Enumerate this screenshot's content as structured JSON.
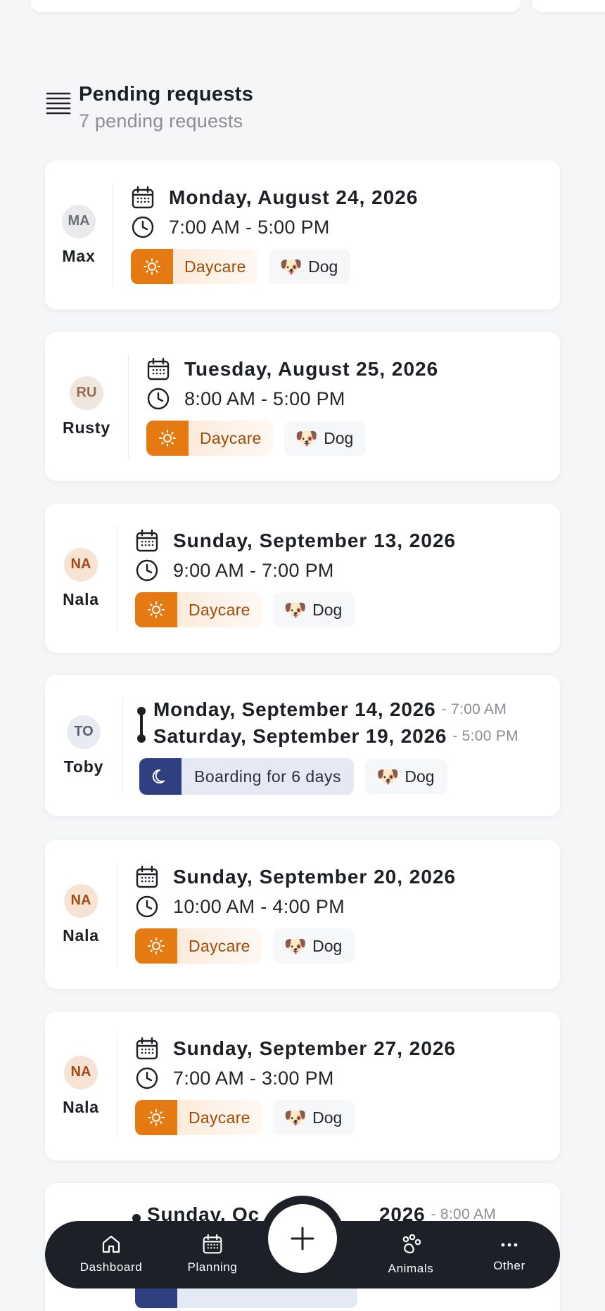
{
  "section": {
    "title": "Pending requests",
    "subtitle": "7 pending requests"
  },
  "requests": [
    {
      "initials": "MA",
      "name": "Max",
      "date": "Monday, August 24, 2026",
      "time": "7:00 AM - 5:00 PM",
      "service": "Daycare",
      "animal": "Dog"
    },
    {
      "initials": "RU",
      "name": "Rusty",
      "date": "Tuesday, August 25, 2026",
      "time": "8:00 AM - 5:00 PM",
      "service": "Daycare",
      "animal": "Dog"
    },
    {
      "initials": "NA",
      "name": "Nala",
      "date": "Sunday, September 13, 2026",
      "time": "9:00 AM - 7:00 PM",
      "service": "Daycare",
      "animal": "Dog"
    },
    {
      "initials": "TO",
      "name": "Toby",
      "start_date": "Monday, September 14, 2026",
      "start_time": "- 7:00 AM",
      "end_date": "Saturday, September 19, 2026",
      "end_time": "- 5:00 PM",
      "service": "Boarding for 6 days",
      "animal": "Dog"
    },
    {
      "initials": "NA",
      "name": "Nala",
      "date": "Sunday, September 20, 2026",
      "time": "10:00 AM - 4:00 PM",
      "service": "Daycare",
      "animal": "Dog"
    },
    {
      "initials": "NA",
      "name": "Nala",
      "date": "Sunday, September 27, 2026",
      "time": "7:00 AM - 3:00 PM",
      "service": "Daycare",
      "animal": "Dog"
    },
    {
      "start_date": "Sunday, Oc",
      "start_date_tail": "2026",
      "start_time": "- 8:00 AM"
    }
  ],
  "nav": {
    "dashboard": "Dashboard",
    "planning": "Planning",
    "animals": "Animals",
    "other": "Other"
  },
  "colors": {
    "daycare": "#e67a12",
    "boarding": "#2f3f7f",
    "nav_bg": "#1d2127"
  },
  "icons": {
    "section": "list-icon",
    "date": "calendar-icon",
    "time": "clock-icon",
    "daycare": "sun-icon",
    "boarding": "moon-icon",
    "animal": "dog-emoji",
    "fab": "plus-icon"
  }
}
